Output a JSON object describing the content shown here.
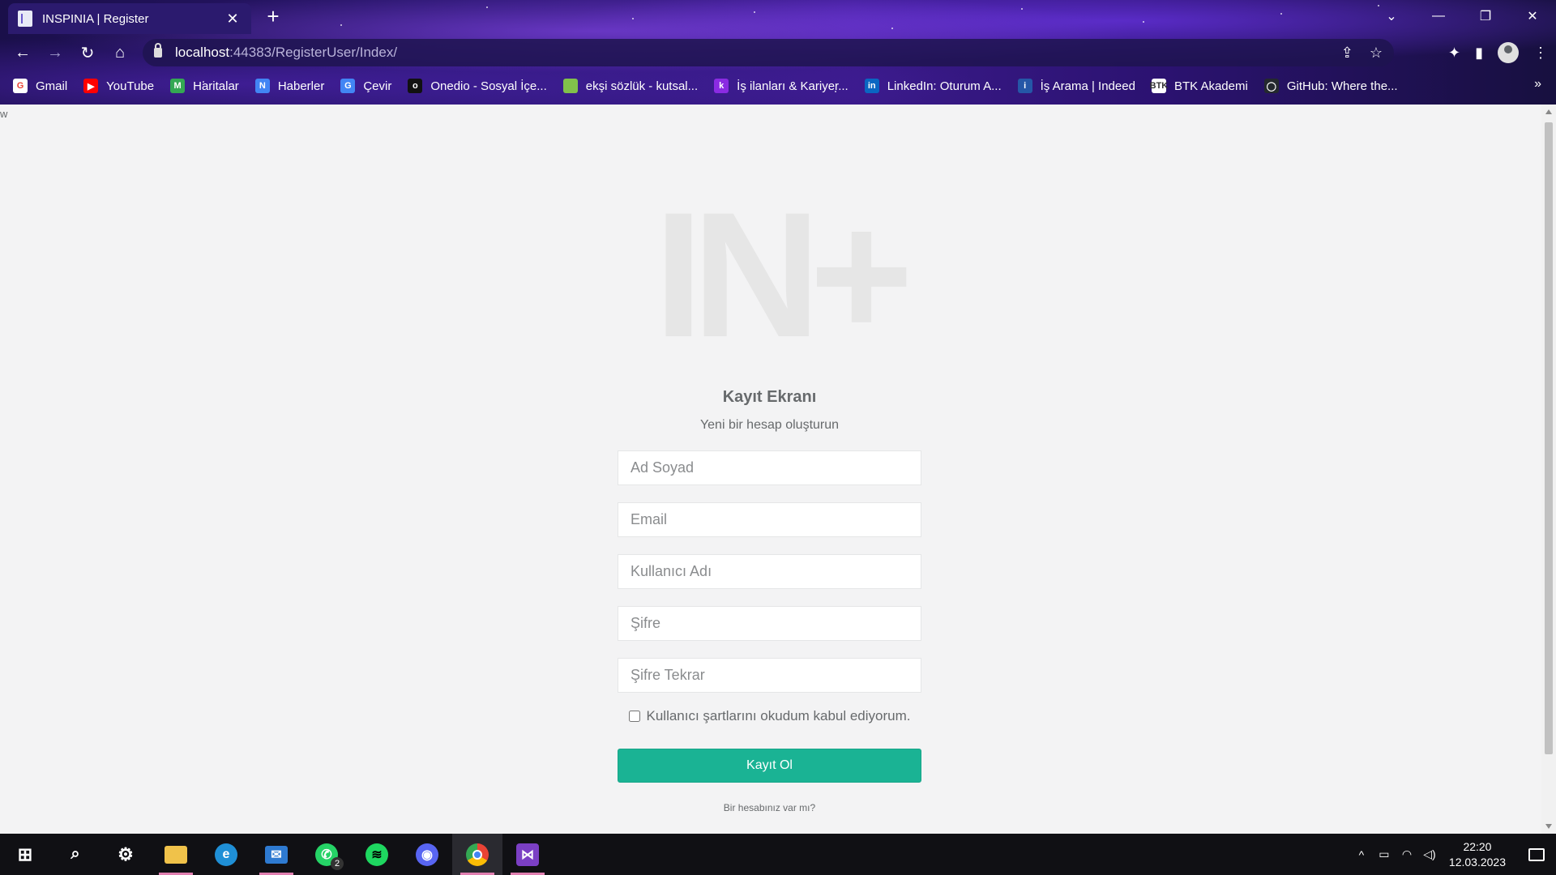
{
  "browser": {
    "tab_title": "INSPINIA | Register",
    "url_host": "localhost",
    "url_rest": ":44383/RegisterUser/Index/",
    "bookmarks": [
      {
        "label": "Gmail",
        "color": "#ffffff",
        "text": "G",
        "text_color": "#ea4335"
      },
      {
        "label": "YouTube",
        "color": "#ff0000",
        "text": "▶",
        "text_color": "#ffffff"
      },
      {
        "label": "Haritalar",
        "color": "#34a853",
        "text": "M",
        "text_color": "#ffffff"
      },
      {
        "label": "Haberler",
        "color": "#4285f4",
        "text": "N",
        "text_color": "#ffffff"
      },
      {
        "label": "Çevir",
        "color": "#4285f4",
        "text": "G",
        "text_color": "#ffffff"
      },
      {
        "label": "Onedio - Sosyal İçe...",
        "color": "#111111",
        "text": "o",
        "text_color": "#ffffff"
      },
      {
        "label": "ekşi sözlük - kutsal...",
        "color": "#81c14b",
        "text": "●",
        "text_color": "#81c14b"
      },
      {
        "label": "İş ilanları & Kariyer...",
        "color": "#8a2be2",
        "text": "k",
        "text_color": "#ffffff"
      },
      {
        "label": "LinkedIn: Oturum A...",
        "color": "#0a66c2",
        "text": "in",
        "text_color": "#ffffff"
      },
      {
        "label": "İş Arama | Indeed",
        "color": "#2557a7",
        "text": "i",
        "text_color": "#ffffff"
      },
      {
        "label": "BTK Akademi",
        "color": "#ffffff",
        "text": "BTK",
        "text_color": "#333333"
      },
      {
        "label": "GitHub: Where the...",
        "color": "#24292e",
        "text": "◯",
        "text_color": "#ffffff"
      }
    ],
    "bookmarks_more": "»"
  },
  "page": {
    "stray_text": "w",
    "logo": "IN+",
    "title": "Kayıt Ekranı",
    "subtitle": "Yeni bir hesap oluşturun",
    "fields": {
      "fullname_placeholder": "Ad Soyad",
      "email_placeholder": "Email",
      "username_placeholder": "Kullanıcı Adı",
      "password_placeholder": "Şifre",
      "password_confirm_placeholder": "Şifre Tekrar"
    },
    "terms_label": "Kullanıcı şartlarını okudum kabul ediyorum.",
    "terms_checked": false,
    "submit_label": "Kayıt Ol",
    "login_link": "Bir hesabınız var mı?",
    "accent_color": "#1ab394"
  },
  "taskbar": {
    "apps": [
      {
        "name": "start",
        "icon": "windows-icon"
      },
      {
        "name": "search",
        "icon": "search-icon"
      },
      {
        "name": "settings",
        "icon": "gear-icon"
      },
      {
        "name": "file-explorer",
        "icon": "folder-icon"
      },
      {
        "name": "edge",
        "icon": "edge-icon"
      },
      {
        "name": "mail",
        "icon": "mail-icon"
      },
      {
        "name": "whatsapp",
        "icon": "whatsapp-icon",
        "badge": "2"
      },
      {
        "name": "spotify",
        "icon": "spotify-icon"
      },
      {
        "name": "discord",
        "icon": "discord-icon"
      },
      {
        "name": "chrome",
        "icon": "chrome-icon"
      },
      {
        "name": "visual-studio",
        "icon": "visual-studio-icon"
      }
    ],
    "time": "22:20",
    "date": "12.03.2023"
  }
}
